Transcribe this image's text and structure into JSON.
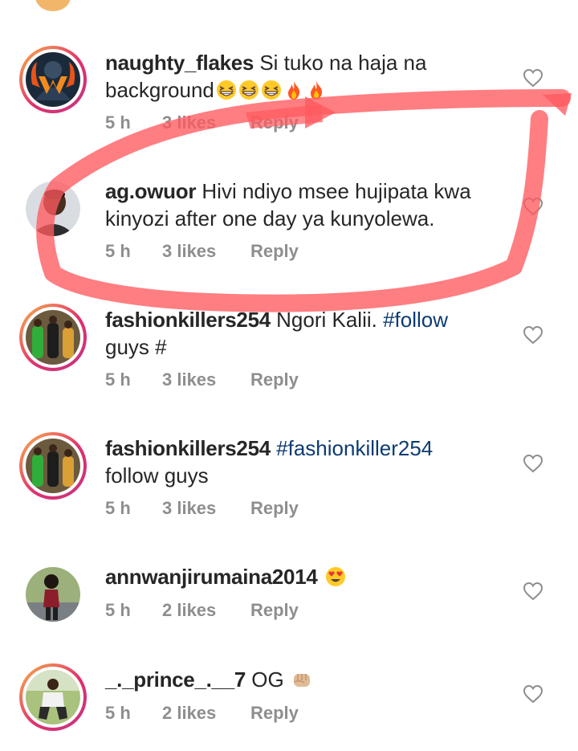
{
  "comments": [
    {
      "username": "naughty_flakes",
      "text_line1": "Si tuko na haja na",
      "text_line2": "background",
      "emoji": [
        "grinning-squint-emoji",
        "grinning-squint-emoji",
        "grinning-squint-emoji",
        "fire-emoji",
        "fire-emoji"
      ],
      "time": "5 h",
      "likes": "3 likes",
      "reply": "Reply"
    },
    {
      "username": "ag.owuor",
      "text_line1": "Hivi ndiyo msee hujipata kwa",
      "text_line2": "kinyozi after one day ya kunyolewa.",
      "time": "5 h",
      "likes": "3 likes",
      "reply": "Reply"
    },
    {
      "username": "fashionkillers254",
      "text_line1": "Ngori Kalii.",
      "hashtag": "#follow",
      "text_line2": "guys #",
      "time": "5 h",
      "likes": "3 likes",
      "reply": "Reply"
    },
    {
      "username": "fashionkillers254",
      "hashtag": "#fashionkiller254",
      "text_line2": "follow guys",
      "time": "5 h",
      "likes": "3 likes",
      "reply": "Reply"
    },
    {
      "username": "annwanjirumaina2014",
      "emoji": [
        "heart-eyes-emoji"
      ],
      "time": "5 h",
      "likes": "2 likes",
      "reply": "Reply"
    },
    {
      "username": "_._prince_.__7",
      "text_line1": "OG",
      "emoji": [
        "fist-emoji"
      ],
      "time": "5 h",
      "likes": "2 likes",
      "reply": "Reply"
    }
  ],
  "colors": {
    "text": "#262626",
    "meta": "#8e8e8e",
    "hashtag": "#0c3b73",
    "annotation": "#ff5a5f",
    "story_ring_start": "#f9b34a",
    "story_ring_end": "#c13584"
  }
}
